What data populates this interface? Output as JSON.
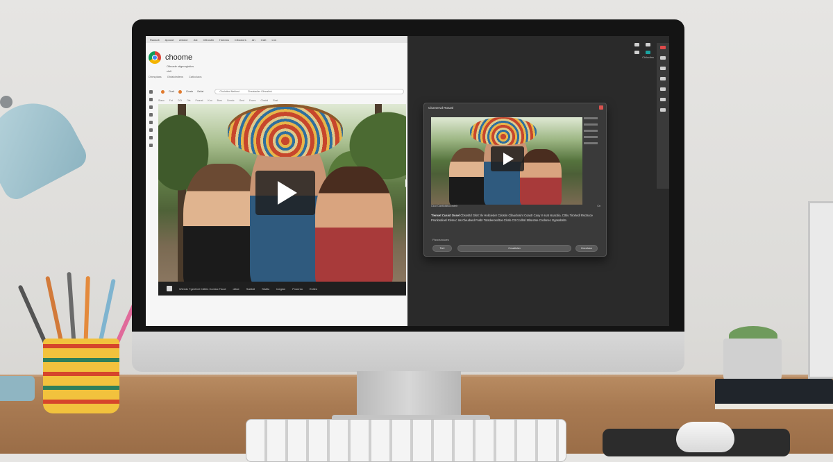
{
  "os_bar": {
    "items": [
      "Raosoit",
      "Apocat",
      "Antolor",
      "Ast",
      "Cltbostin",
      "Hoedos",
      "Clbooiors",
      "Ah",
      "Cslit",
      "Lnn"
    ]
  },
  "browser": {
    "brand": "choome",
    "brand_sub": [
      "Olbcade stigerogistics",
      "cloli"
    ],
    "links": [
      "Dhesplass",
      "Ghtalctatlens",
      "Caticclaos"
    ],
    "tabs": [
      "Cbalt",
      "Cleate",
      "Bellat"
    ],
    "address": [
      "Cholotted Nebinst",
      "Cheataciler Glinoslink"
    ],
    "toolbar": [
      "Slaso",
      "Fnt",
      "CGt",
      "Ots",
      "Pcanat",
      "Kno",
      "Bnrs",
      "Cnnslc",
      "Gnst",
      "Fnwrc",
      "Clnstal",
      "Rnst"
    ],
    "video": {
      "play_label": "Play"
    },
    "caption": [
      "Wivedc Tgentbel Cdthin Conisic Tkcot",
      "ollioe",
      "Sabbdl",
      "Ststilo",
      "Inegion",
      "Pxonnto",
      "Enlles"
    ]
  },
  "workspace": {
    "tool_label": "Ckilocitss",
    "dialog": {
      "title": "Clunnervd Rosasl",
      "status_left": "Clcor Dantlolsttcccrotelr",
      "status_right": "Cn",
      "text_bold": "Tlenset Cusist Ossel",
      "text": "Cbsosltd Glsrt: Ilv Holicieder Cdostin Cllauclosint Coastr Caoy Ir scat Iscacbio, Ctttiu Tirortedl Rsctscce Prsnlosdiosl Rlvmcc Iss Cleudsed Fnsbr Totsdenoscltos Clsrlo Ctt Ccclltsl Stlsnctse Cnclsnec Ggnssbsltn",
      "footer_label": "Flsnosroaces",
      "buttons": {
        "left": "Tcnl",
        "center": "Cvsatiolsn",
        "right": "Uncoluso"
      }
    }
  }
}
